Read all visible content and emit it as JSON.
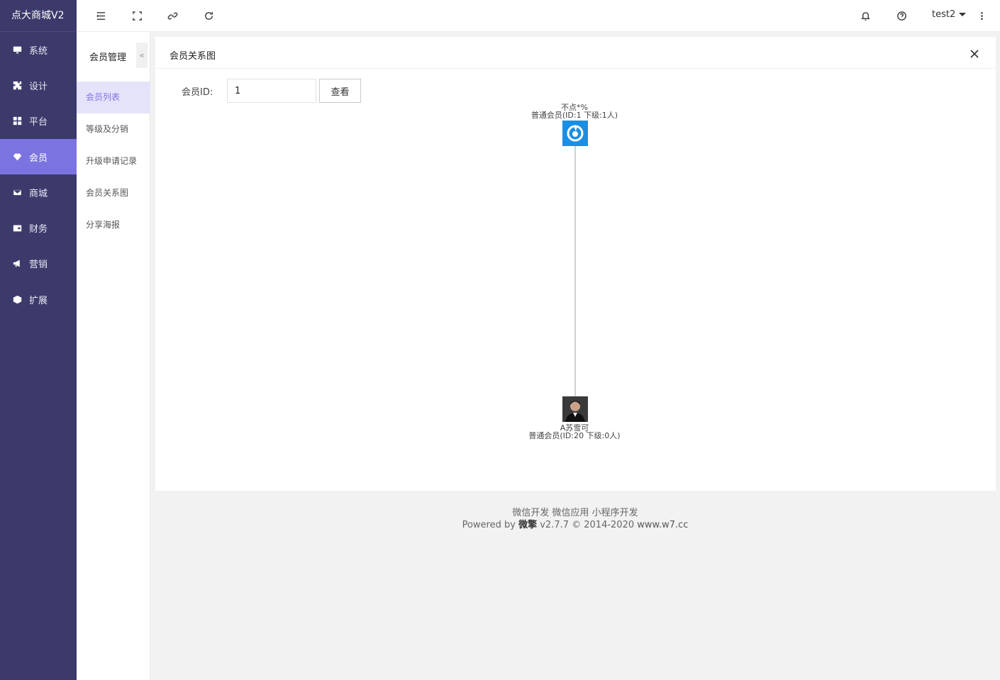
{
  "brand": "点大商城V2",
  "sidebar": {
    "items": [
      {
        "label": "系统",
        "icon": "monitor-icon"
      },
      {
        "label": "设计",
        "icon": "puzzle-icon"
      },
      {
        "label": "平台",
        "icon": "grid-icon"
      },
      {
        "label": "会员",
        "icon": "diamond-icon",
        "active": true
      },
      {
        "label": "商城",
        "icon": "mail-icon"
      },
      {
        "label": "财务",
        "icon": "wallet-icon"
      },
      {
        "label": "营销",
        "icon": "megaphone-icon"
      },
      {
        "label": "扩展",
        "icon": "cube-icon"
      }
    ]
  },
  "subnav": {
    "title": "会员管理",
    "collapse": "«",
    "items": [
      {
        "label": "会员列表",
        "active": true
      },
      {
        "label": "等级及分销"
      },
      {
        "label": "升级申请记录"
      },
      {
        "label": "会员关系图"
      },
      {
        "label": "分享海报"
      }
    ]
  },
  "topbar": {
    "user": "test2"
  },
  "card": {
    "title": "会员关系图",
    "form": {
      "label": "会员ID:",
      "value": "1",
      "button": "查看"
    }
  },
  "graph": {
    "root": {
      "name": "不点*%",
      "info": "普通会员(ID:1 下级:1人)"
    },
    "child": {
      "name": "A苏雪可",
      "info": "普通会员(ID:20 下级:0人)"
    }
  },
  "footer": {
    "links": "微信开发 微信应用 小程序开发",
    "powered": "Powered by",
    "product": "微擎",
    "version": "v2.7.7 © 2014-2020",
    "site": "www.w7.cc"
  },
  "colors": {
    "sidebar": "#3b3a6b",
    "accent": "#7b74e0",
    "root_avatar": "#1a8fe3"
  }
}
